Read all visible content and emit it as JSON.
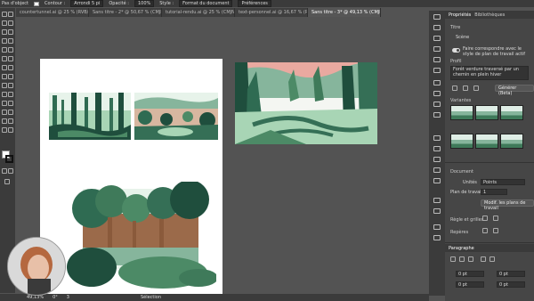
{
  "control_bar": {
    "selection_label": "Pas d'object",
    "stroke_label": "Contour :",
    "brush_label": "Arrondi 5 pi",
    "opacity_label": "Opacité :",
    "opacity_value": "100%",
    "style_label": "Style :",
    "doc_format_button": "Format du document",
    "preferences_button": "Préférences"
  },
  "tabs": [
    {
      "label": "countertunnel.ai @ 25 % (RVB/Aperçu)",
      "active": false
    },
    {
      "label": "Sans titre - 2* @ 50,67 % (CMJN/A...)",
      "active": false
    },
    {
      "label": "tutorial-rendu.ai @ 25 % (CMJN/Ap...)",
      "active": false
    },
    {
      "label": "text-personnel.ai @ 16,67 % (RVB/...)",
      "active": false
    },
    {
      "label": "Sans titre - 3* @ 49,13 % (CMJN/Aperçu)",
      "active": true
    }
  ],
  "properties_panel": {
    "tab_properties": "Propriétés",
    "tab_libraries": "Bibliothèques",
    "section_title": "Titre",
    "doc_section": "Scène",
    "toggle_text": "Faire correspondre avec le style de plan de travail actif",
    "effect_label": "Profil",
    "effect_value": "Forêt verdure traversé par un chemin en plein hiver",
    "action_button": "Générer (Beta)",
    "variations_label": "Variantes",
    "document_label": "Document",
    "units_label": "Unités",
    "units_value": "Points",
    "artboard_label": "Plan de travail",
    "artboard_value": "1",
    "edit_artboards_button": "Modif. les plans de travail",
    "rules_label": "Règle et grilles",
    "guides_label": "Repères",
    "paragraph_title": "Paragraphe",
    "indent1": "0 pt",
    "indent2": "0 pt",
    "indent3": "0 pt",
    "indent4": "0 pt"
  },
  "status_bar": {
    "zoom": "49,13%",
    "angle": "0°",
    "page": "3",
    "tool": "Sélection"
  },
  "colors": {
    "canvas": "#535353",
    "panel": "#464646",
    "forest_dark": "#1f4e3d",
    "forest_mid": "#4c8a66",
    "forest_light": "#a8d5b5",
    "sky": "#ffffff",
    "trunk": "#8a5a3b",
    "accent_pink": "#e9a9a0"
  },
  "icons": [
    "selection-icon",
    "direct-select-icon",
    "pen-icon",
    "type-icon",
    "brush-icon",
    "eraser-icon",
    "rotate-icon",
    "zoom-icon",
    "hand-icon",
    "gear-icon",
    "layers-icon"
  ]
}
